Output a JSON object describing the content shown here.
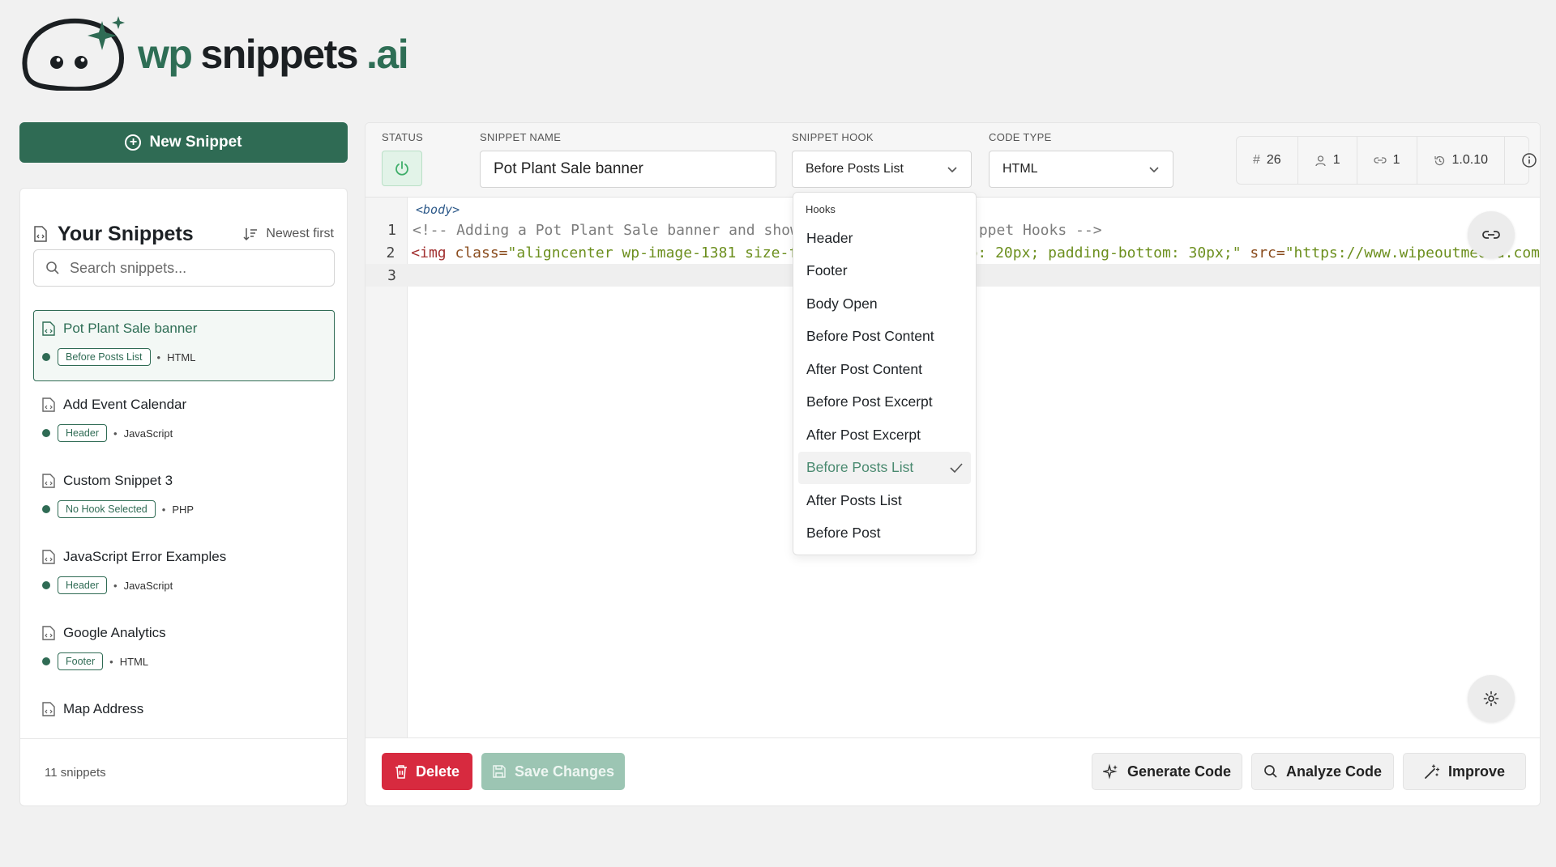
{
  "brand": {
    "wp": "wp",
    "snippets": "snippets",
    "ai": ".ai"
  },
  "sidebar": {
    "new_snippet_label": "New Snippet",
    "title": "Your Snippets",
    "sort_label": "Newest first",
    "search_placeholder": "Search snippets...",
    "snippets": [
      {
        "name": "Pot Plant Sale banner",
        "hook": "Before Posts List",
        "type": "HTML",
        "active": true
      },
      {
        "name": "Add Event Calendar",
        "hook": "Header",
        "type": "JavaScript"
      },
      {
        "name": "Custom Snippet 3",
        "hook": "No Hook Selected",
        "type": "PHP"
      },
      {
        "name": "JavaScript Error Examples",
        "hook": "Header",
        "type": "JavaScript"
      },
      {
        "name": "Google Analytics",
        "hook": "Footer",
        "type": "HTML"
      },
      {
        "name": "Map Address"
      }
    ],
    "count_label": "11 snippets"
  },
  "topbar": {
    "status_label": "STATUS",
    "name_label": "SNIPPET NAME",
    "name_value": "Pot Plant Sale banner",
    "hook_label": "SNIPPET HOOK",
    "hook_value": "Before Posts List",
    "type_label": "CODE TYPE",
    "type_value": "HTML",
    "stats": {
      "id": "26",
      "users": "1",
      "links": "1",
      "version": "1.0.10"
    }
  },
  "editor": {
    "crumb": "<body>",
    "line1_num": "1",
    "line1_text": "<!-- Adding a Pot Plant Sale banner and show",
    "line1_tail": "ppet Hooks -->",
    "line2_num": "2",
    "line2_tag": "<img ",
    "line2_attr1": "class=",
    "line2_val1": "\"aligncenter wp-image-1381 size-f",
    "line2_mid": "op: 20px; padding-bottom: 30px;\"",
    "line2_attr2": " src=",
    "line2_val2": "\"https://www.wipeoutmedia.com",
    "line3_num": "3"
  },
  "bottombar": {
    "delete_label": "Delete",
    "save_label": "Save Changes",
    "generate_label": "Generate Code",
    "analyze_label": "Analyze Code",
    "improve_label": "Improve"
  },
  "dropdown": {
    "heading": "Hooks",
    "items": [
      "Header",
      "Footer",
      "Body Open",
      "Before Post Content",
      "After Post Content",
      "Before Post Excerpt",
      "After Post Excerpt",
      "Before Posts List",
      "After Posts List",
      "Before Post"
    ],
    "selected": "Before Posts List"
  },
  "colors": {
    "brand_green": "#2f6b54",
    "delete_red": "#d72a3f",
    "save_disabled": "#9cc5b3"
  }
}
